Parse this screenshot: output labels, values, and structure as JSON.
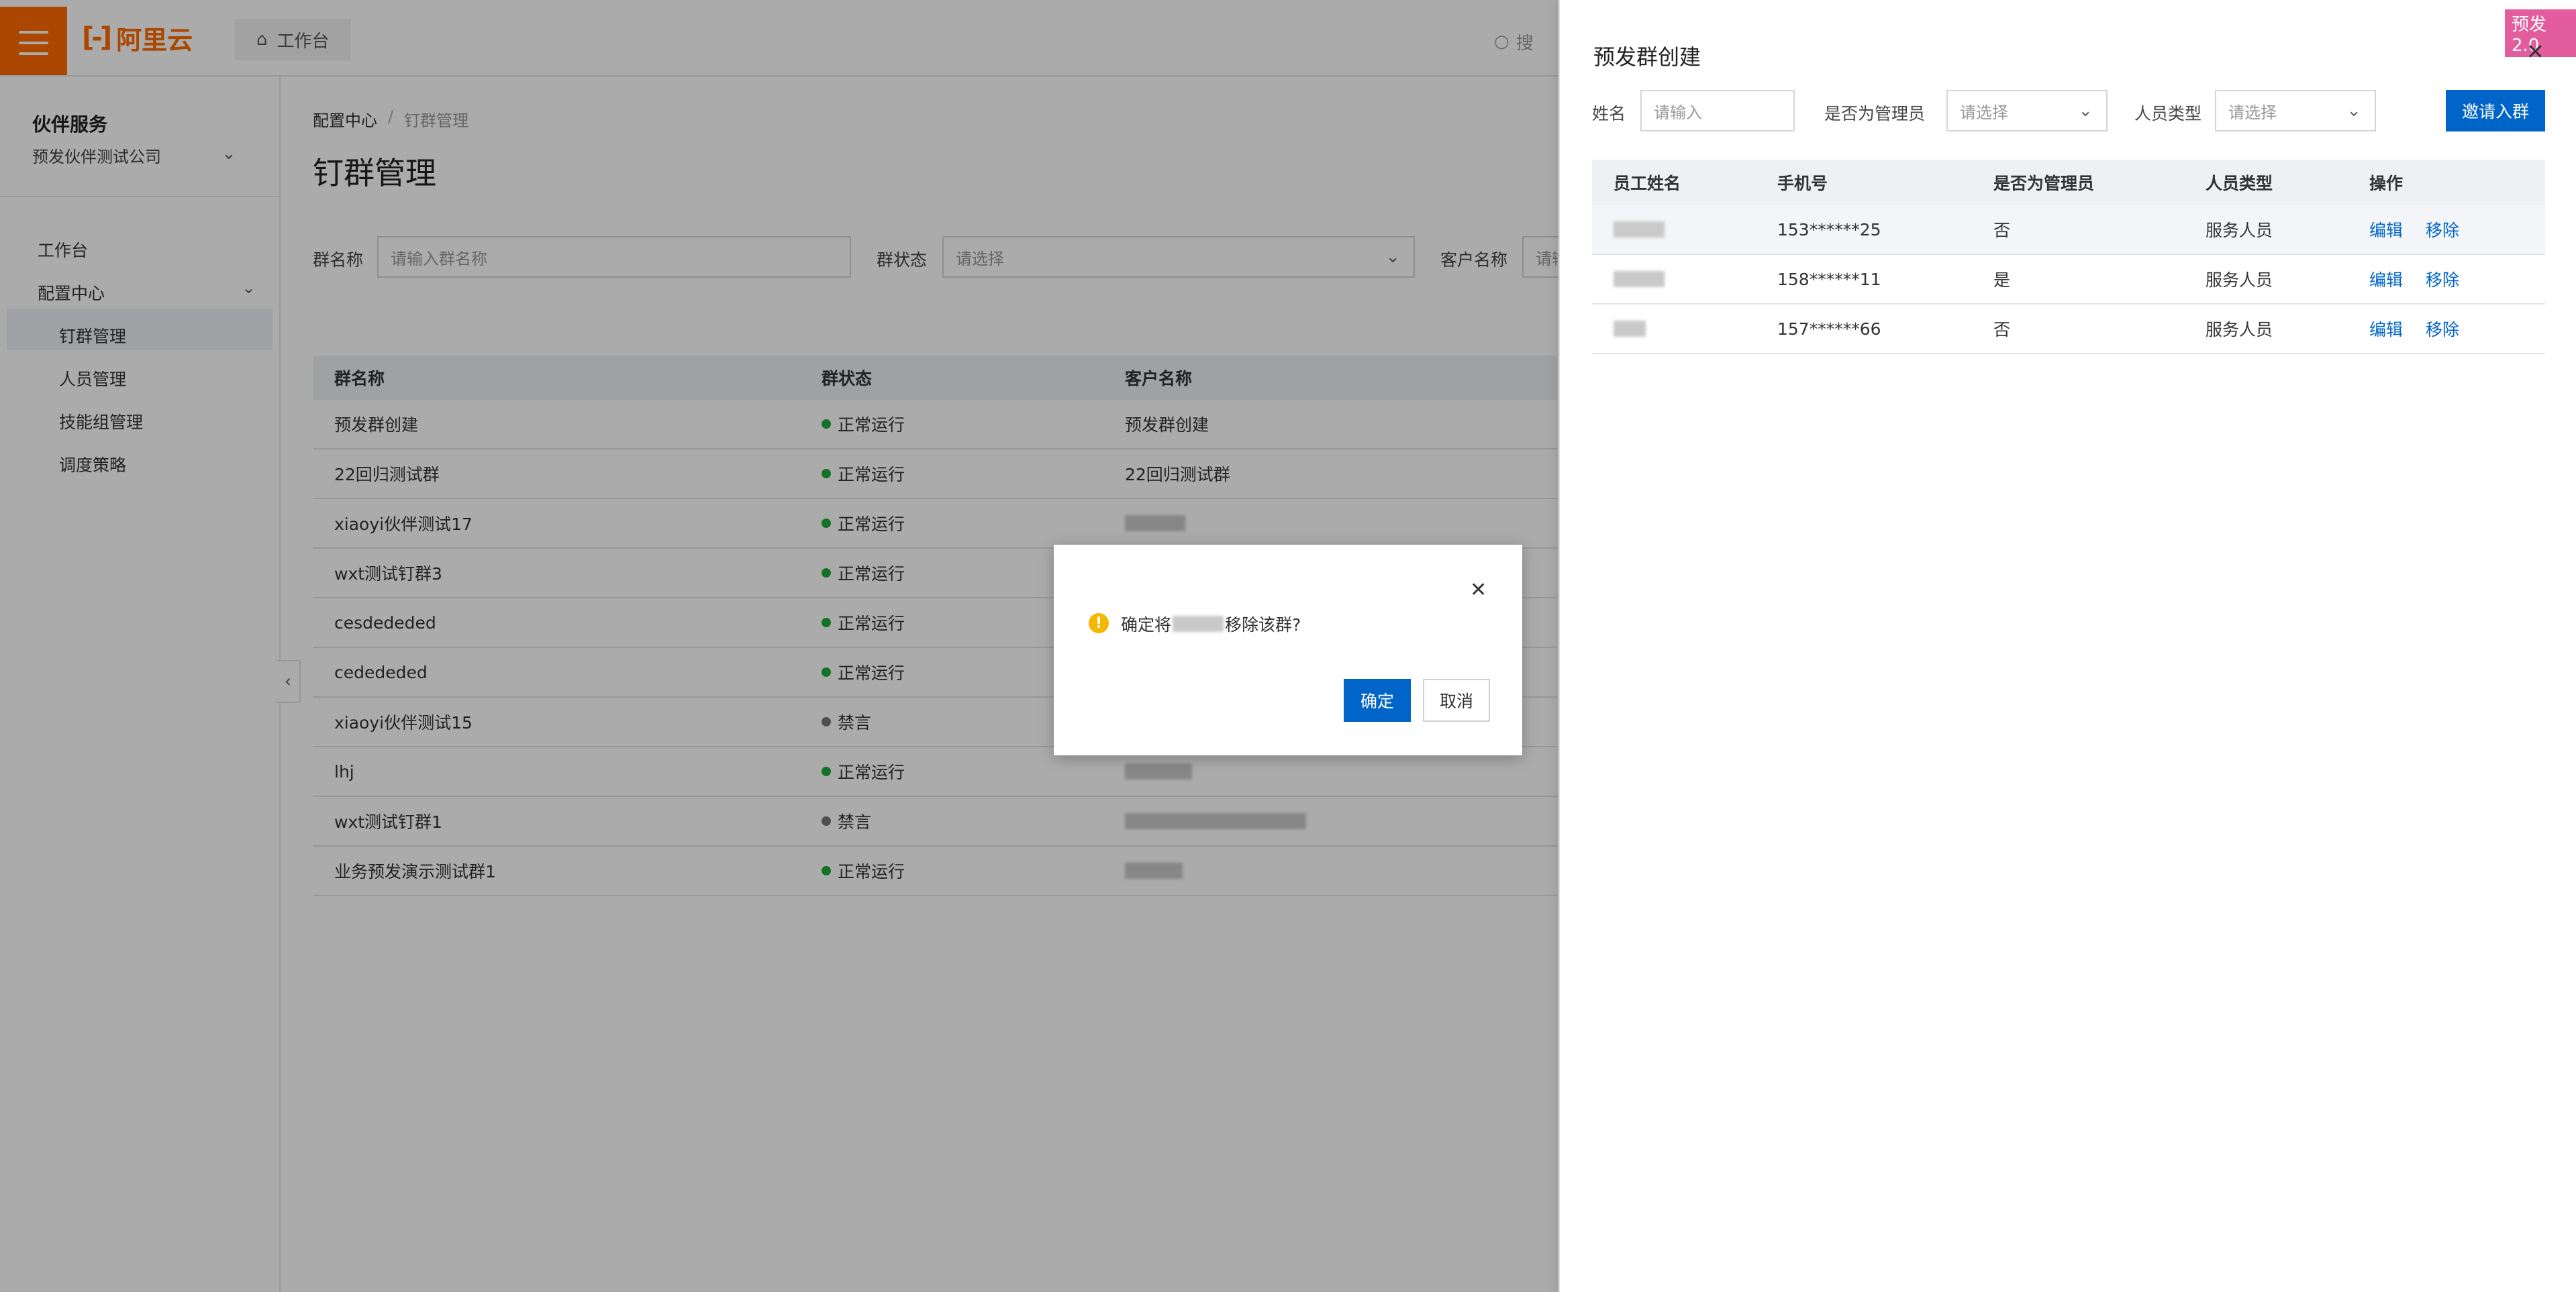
{
  "topbar": {
    "brand": "阿里云",
    "home_tab": "工作台",
    "search_placeholder": "搜"
  },
  "sidebar": {
    "title": "伙伴服务",
    "company": "预发伙伴测试公司",
    "items": [
      {
        "label": "工作台"
      },
      {
        "label": "配置中心"
      },
      {
        "label": "钉群管理"
      },
      {
        "label": "人员管理"
      },
      {
        "label": "技能组管理"
      },
      {
        "label": "调度策略"
      }
    ]
  },
  "main": {
    "breadcrumb": [
      "配置中心",
      "/",
      "钉群管理"
    ],
    "title": "钉群管理",
    "filters": {
      "group_name_label": "群名称",
      "group_name_placeholder": "请输入群名称",
      "status_label": "群状态",
      "status_placeholder": "请选择",
      "customer_label": "客户名称",
      "customer_placeholder": "请输"
    },
    "table": {
      "headers": [
        "群名称",
        "群状态",
        "客户名称"
      ],
      "rows": [
        {
          "name": "预发群创建",
          "status": "正常运行",
          "customer": "预发群创建"
        },
        {
          "name": "22回归测试群",
          "status": "正常运行",
          "customer": "22回归测试群"
        },
        {
          "name": "xiaoyi伙伴测试17",
          "status": "正常运行",
          "customer": ""
        },
        {
          "name": "wxt测试钉群3",
          "status": "正常运行",
          "customer": ""
        },
        {
          "name": "cesdededed",
          "status": "正常运行",
          "customer": ""
        },
        {
          "name": "cedededed",
          "status": "正常运行",
          "customer": ""
        },
        {
          "name": "xiaoyi伙伴测试15",
          "status": "禁言",
          "customer": ""
        },
        {
          "name": "lhj",
          "status": "正常运行",
          "customer": ""
        },
        {
          "name": "wxt测试钉群1",
          "status": "禁言",
          "customer": ""
        },
        {
          "name": "业务预发演示测试群1",
          "status": "正常运行",
          "customer": ""
        }
      ]
    }
  },
  "modal": {
    "message_prefix": "确定将",
    "message_suffix": "移除该群?",
    "ok": "确定",
    "cancel": "取消"
  },
  "drawer": {
    "title": "预发群创建",
    "env_tag": "预发2.0",
    "filters": {
      "name_label": "姓名",
      "name_placeholder": "请输入",
      "admin_label": "是否为管理员",
      "admin_placeholder": "请选择",
      "type_label": "人员类型",
      "type_placeholder": "请选择"
    },
    "invite_button": "邀请入群",
    "table": {
      "headers": [
        "员工姓名",
        "手机号",
        "是否为管理员",
        "人员类型",
        "操作"
      ],
      "rows": [
        {
          "phone": "153******25",
          "admin": "否",
          "type": "服务人员"
        },
        {
          "phone": "158******11",
          "admin": "是",
          "type": "服务人员"
        },
        {
          "phone": "157******66",
          "admin": "否",
          "type": "服务人员"
        }
      ],
      "edit": "编辑",
      "remove": "移除"
    }
  },
  "colors": {
    "brand": "#ff6a00",
    "primary": "#0064c8",
    "status_normal": "#1dab3a",
    "status_muted": "#777777",
    "env_tag": "#e35d9e"
  }
}
